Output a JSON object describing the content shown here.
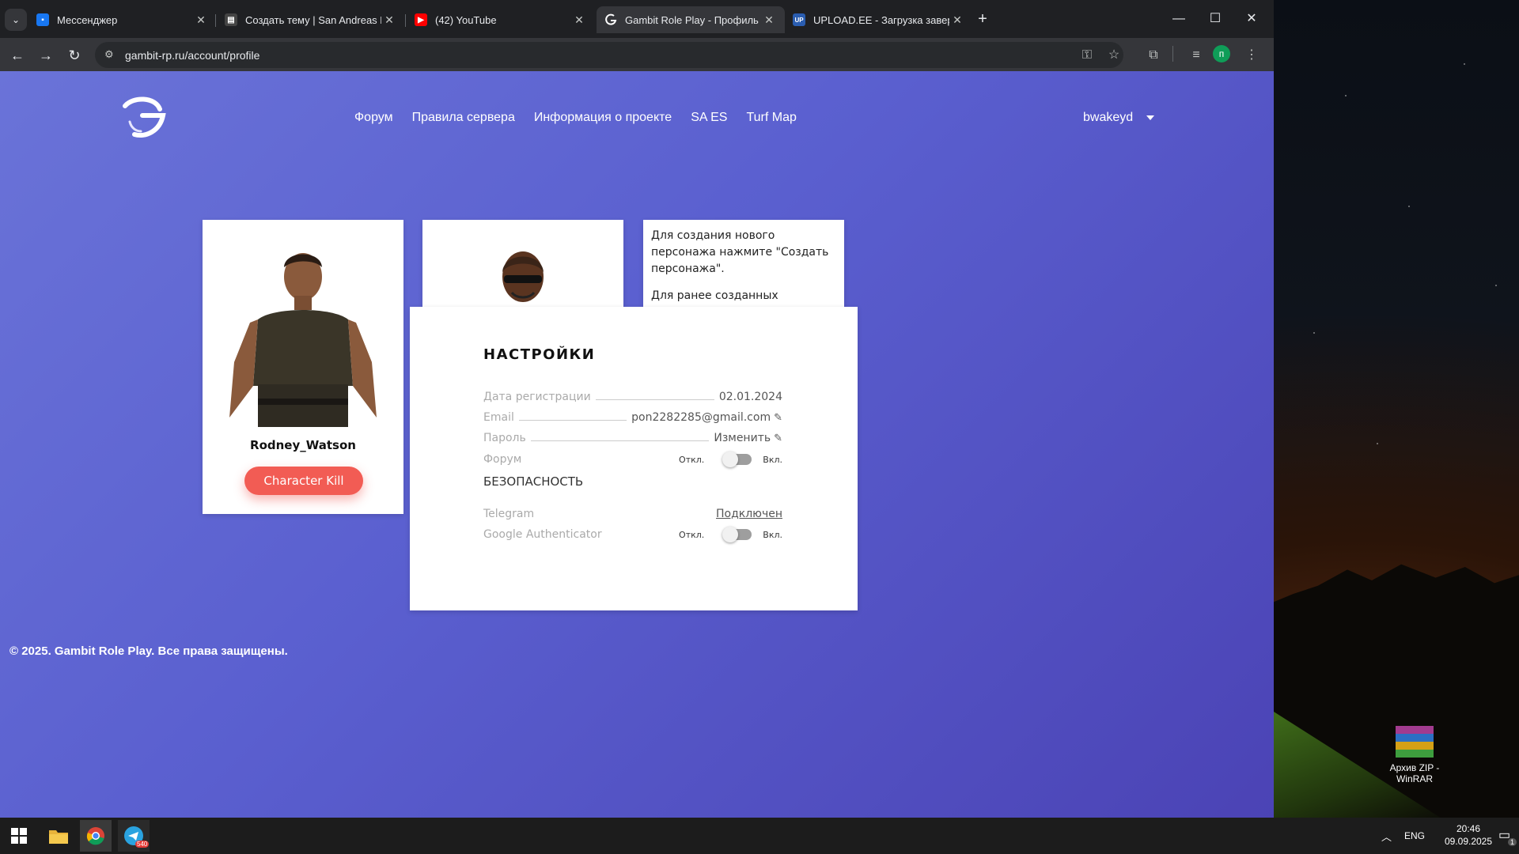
{
  "browser": {
    "tabs": [
      {
        "title": "Мессенджер",
        "favicon": "messenger-icon",
        "color": "#1877f2",
        "glyph": "💬",
        "active": false
      },
      {
        "title": "Создать тему | San Andreas Em",
        "favicon": "forum-icon",
        "color": "#444444",
        "glyph": "SA",
        "active": false
      },
      {
        "title": "(42) YouTube",
        "favicon": "youtube-icon",
        "color": "#ff0000",
        "glyph": "▶",
        "active": false
      },
      {
        "title": "Gambit Role Play - Профиль U",
        "favicon": "gambit-icon",
        "color": "#555555",
        "glyph": "G",
        "active": true
      },
      {
        "title": "UPLOAD.EE - Загрузка заверш",
        "favicon": "upload-icon",
        "color": "#2a5db0",
        "glyph": "UP",
        "active": false
      }
    ],
    "url": "gambit-rp.ru/account/profile",
    "profile_initial": "п"
  },
  "site": {
    "nav": [
      "Форум",
      "Правила сервера",
      "Информация о проекте",
      "SA ES",
      "Turf Map"
    ],
    "username": "bwakeyd",
    "character": {
      "name": "Rodney_Watson",
      "kill_button": "Character Kill"
    },
    "info_text_1": "Для создания нового персонажа нажмите \"Создать персонажа\".",
    "info_text_2": "Для ранее созданных персонажей нажмите \"Добавить персонажа\".",
    "settings": {
      "title": "НАСТРОЙКИ",
      "reg_label": "Дата регистрации",
      "reg_value": "02.01.2024",
      "email_label": "Email",
      "email_value": "pon2282285@gmail.com",
      "password_label": "Пароль",
      "password_value": "Изменить",
      "forum_label": "Форум",
      "off": "Откл.",
      "on": "Вкл.",
      "security_title": "БЕЗОПАСНОСТЬ",
      "telegram_label": "Telegram",
      "telegram_value": "Подключен",
      "ga_label": "Google Authenticator"
    },
    "footer": "© 2025. Gambit Role Play. Все права защищены."
  },
  "desktop": {
    "icon_label_1": "Архив ZIP -",
    "icon_label_2": "WinRAR"
  },
  "taskbar": {
    "lang": "ENG",
    "time": "20:46",
    "date": "09.09.2025",
    "telegram_badge": "540",
    "notif_count": "1"
  }
}
